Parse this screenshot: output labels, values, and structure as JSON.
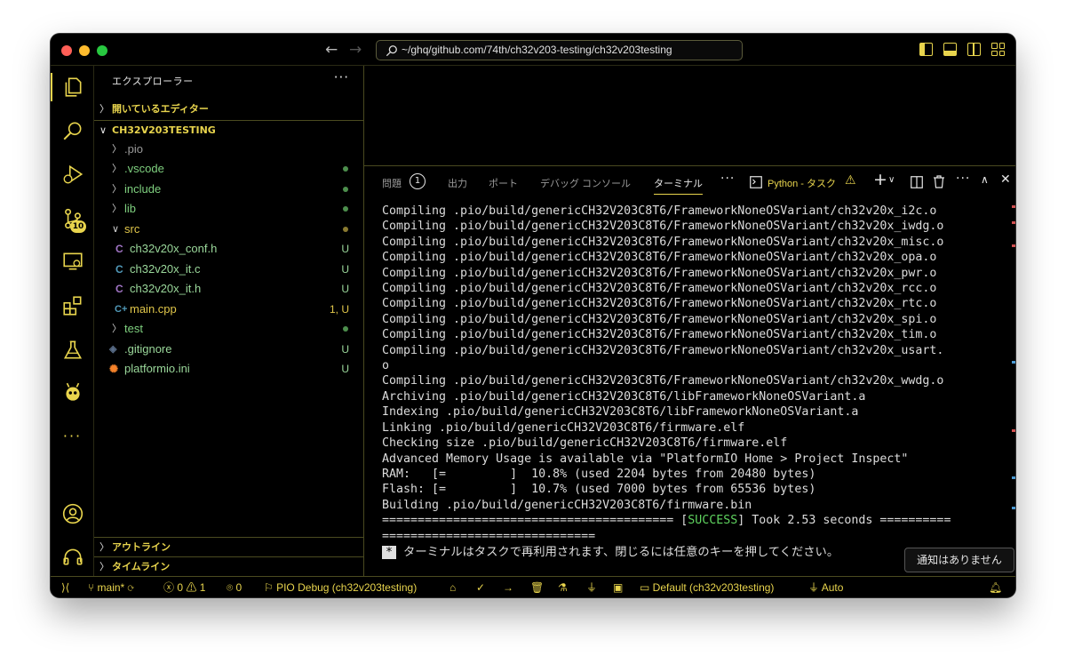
{
  "window": {
    "search": "~/ghq/github.com/74th/ch32v203-testing/ch32v203testing"
  },
  "sidebar": {
    "title": "エクスプローラー",
    "more": "···",
    "open_editors": "開いているエディター",
    "root": "CH32V203TESTING",
    "items": [
      {
        "name": ".pio",
        "type": "folder",
        "status": ""
      },
      {
        "name": ".vscode",
        "type": "folder",
        "status": "dot"
      },
      {
        "name": "include",
        "type": "folder",
        "status": "dot"
      },
      {
        "name": "lib",
        "type": "folder",
        "status": "dot"
      },
      {
        "name": "src",
        "type": "folder-open",
        "status": "dot"
      },
      {
        "name": "ch32v20x_conf.h",
        "type": "c",
        "status": "U"
      },
      {
        "name": "ch32v20x_it.c",
        "type": "c",
        "status": "U"
      },
      {
        "name": "ch32v20x_it.h",
        "type": "c",
        "status": "U"
      },
      {
        "name": "main.cpp",
        "type": "cpp",
        "status": "1, U"
      },
      {
        "name": "test",
        "type": "folder",
        "status": "dot"
      },
      {
        "name": ".gitignore",
        "type": "git",
        "status": "U"
      },
      {
        "name": "platformio.ini",
        "type": "pio",
        "status": "U"
      }
    ],
    "outline": "アウトライン",
    "timeline": "タイムライン"
  },
  "activity": {
    "scm_badge": "10"
  },
  "panel": {
    "tabs": {
      "problems": "問題",
      "problems_count": "1",
      "output": "出力",
      "ports": "ポート",
      "debug_console": "デバッグ コンソール",
      "terminal": "ターミナル"
    },
    "task": "Python - タスク",
    "terminal_lines": [
      "Compiling .pio/build/genericCH32V203C8T6/FrameworkNoneOSVariant/ch32v20x_i2c.o",
      "Compiling .pio/build/genericCH32V203C8T6/FrameworkNoneOSVariant/ch32v20x_iwdg.o",
      "Compiling .pio/build/genericCH32V203C8T6/FrameworkNoneOSVariant/ch32v20x_misc.o",
      "Compiling .pio/build/genericCH32V203C8T6/FrameworkNoneOSVariant/ch32v20x_opa.o",
      "Compiling .pio/build/genericCH32V203C8T6/FrameworkNoneOSVariant/ch32v20x_pwr.o",
      "Compiling .pio/build/genericCH32V203C8T6/FrameworkNoneOSVariant/ch32v20x_rcc.o",
      "Compiling .pio/build/genericCH32V203C8T6/FrameworkNoneOSVariant/ch32v20x_rtc.o",
      "Compiling .pio/build/genericCH32V203C8T6/FrameworkNoneOSVariant/ch32v20x_spi.o",
      "Compiling .pio/build/genericCH32V203C8T6/FrameworkNoneOSVariant/ch32v20x_tim.o",
      "Compiling .pio/build/genericCH32V203C8T6/FrameworkNoneOSVariant/ch32v20x_usart.",
      "o",
      "Compiling .pio/build/genericCH32V203C8T6/FrameworkNoneOSVariant/ch32v20x_wwdg.o",
      "Archiving .pio/build/genericCH32V203C8T6/libFrameworkNoneOSVariant.a",
      "Indexing .pio/build/genericCH32V203C8T6/libFrameworkNoneOSVariant.a",
      "Linking .pio/build/genericCH32V203C8T6/firmware.elf",
      "Checking size .pio/build/genericCH32V203C8T6/firmware.elf",
      "Advanced Memory Usage is available via \"PlatformIO Home > Project Inspect\"",
      "RAM:   [=         ]  10.8% (used 2204 bytes from 20480 bytes)",
      "Flash: [=         ]  10.7% (used 7000 bytes from 65536 bytes)",
      "Building .pio/build/genericCH32V203C8T6/firmware.bin"
    ],
    "success_prefix": "========================================= [",
    "success_word": "SUCCESS",
    "success_suffix": "] Took 2.53 seconds ==========",
    "success_cont": "==============================",
    "reuse_marker": "*",
    "reuse_text": "ターミナルはタスクで再利用されます、閉じるには任意のキーを押してください。"
  },
  "tooltip": "通知はありません",
  "status": {
    "branch": "main*",
    "errors": "0",
    "warnings": "1",
    "ports": "0",
    "debug": "PIO Debug (ch32v203testing)",
    "env": "Default (ch32v203testing)",
    "auto": "Auto"
  }
}
